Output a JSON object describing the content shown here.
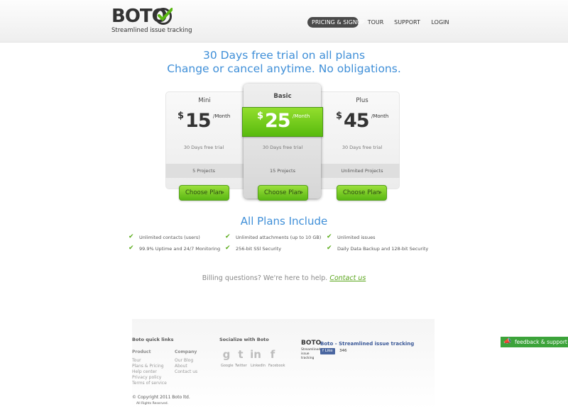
{
  "header": {
    "logo_text": "BOTO",
    "tagline": "Streamlined issue tracking",
    "nav": [
      {
        "label": "PRICING & SIGNUP",
        "active": true
      },
      {
        "label": "TOUR"
      },
      {
        "label": "SUPPORT"
      },
      {
        "label": "LOGIN"
      }
    ]
  },
  "hero": {
    "line1": "30 Days free trial on all plans",
    "line2": "Change or cancel anytime. No obligations."
  },
  "plans": [
    {
      "name": "Mini",
      "currency": "$",
      "price": "15",
      "period": "/Month",
      "trial": "30 Days free trial",
      "projects": "5 Projects",
      "cta": "Choose Plan"
    },
    {
      "name": "Basic",
      "currency": "$",
      "price": "25",
      "period": "/Month",
      "trial": "30 Days free trial",
      "projects": "15 Projects",
      "cta": "Choose Plan",
      "highlighted": true
    },
    {
      "name": "Plus",
      "currency": "$",
      "price": "45",
      "period": "/Month",
      "trial": "30 Days free trial",
      "projects": "Unlimited Projects",
      "cta": "Choose Plan"
    }
  ],
  "includes": {
    "title": "All Plans Include",
    "features": [
      "Unlimited contacts (users)",
      "Unlimited attachments (up to 10 GB)",
      "Unlimited issues",
      "99.9% Uptime and 24/7 Monitoring",
      "256-bit SSl Security",
      "Daily Data Backup and 128-bit Security"
    ]
  },
  "billing": {
    "text": "Billing questions? We're here to help.",
    "link": "Contact us"
  },
  "footer": {
    "quick_links_title": "Boto quick links",
    "product_title": "Product",
    "product_links": [
      "Tour",
      "Plans & Pricing",
      "Help center",
      "Privacy policy",
      "Terms of service"
    ],
    "company_title": "Company",
    "company_links": [
      "Our Blog",
      "About",
      "Contact us"
    ],
    "social_title": "Socialize with Boto",
    "social": [
      {
        "icon": "google-icon",
        "glyph": "g",
        "label": "Google"
      },
      {
        "icon": "twitter-icon",
        "glyph": "t",
        "label": "Twitter"
      },
      {
        "icon": "linkedin-icon",
        "glyph": "in",
        "label": "LinkedIn"
      },
      {
        "icon": "facebook-icon",
        "glyph": "f",
        "label": "Facebook"
      }
    ],
    "fb_logo": "BOTO",
    "fb_tagline": "Streamlined issue tracking",
    "fb_title": "Boto - Streamlined issue tracking",
    "fb_like": "Like",
    "fb_count": "346",
    "copyright": "© Copyright 2011 Boto ltd.",
    "rights": "All Rights Reserved."
  },
  "feedback": {
    "label": "feedback & support"
  },
  "colors": {
    "accent_blue": "#3f8fd8",
    "brand_green": "#5ab713",
    "feedback_green": "#3ca33a"
  }
}
